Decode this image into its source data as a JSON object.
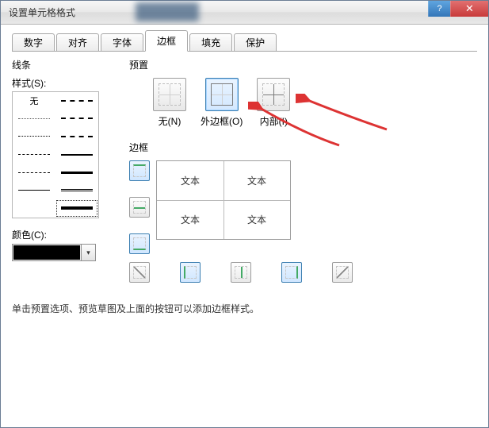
{
  "window": {
    "title": "设置单元格格式"
  },
  "tabs": {
    "items": [
      "数字",
      "对齐",
      "字体",
      "边框",
      "填充",
      "保护"
    ],
    "active_index": 3
  },
  "line_section": {
    "group": "线条",
    "style_label": "样式(S):",
    "none_label": "无",
    "color_label": "颜色(C):",
    "color_value": "#000000"
  },
  "presets": {
    "group": "预置",
    "items": [
      {
        "label": "无(N)"
      },
      {
        "label": "外边框(O)"
      },
      {
        "label": "内部(I)"
      }
    ],
    "selected_index": 1
  },
  "border": {
    "group": "边框",
    "preview_text": "文本"
  },
  "hint": "单击预置选项、预览草图及上面的按钮可以添加边框样式。"
}
